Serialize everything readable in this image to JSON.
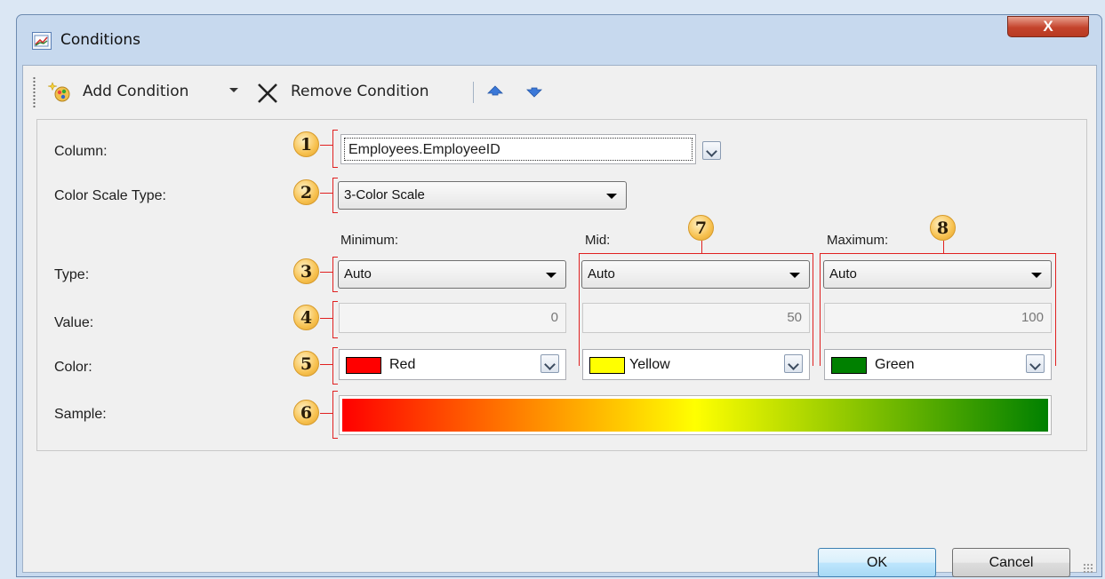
{
  "window": {
    "title": "Conditions",
    "close_glyph": "X",
    "icon": "chart-icon"
  },
  "toolbar": {
    "add_label": "Add Condition",
    "remove_label": "Remove Condition",
    "icons": [
      "add-condition-icon",
      "dropdown-arrow-icon",
      "remove-x-icon",
      "move-up-icon",
      "move-down-icon"
    ]
  },
  "form": {
    "column_label": "Column:",
    "column_value": "Employees.EmployeeID",
    "scale_type_label": "Color Scale Type:",
    "scale_type_value": "3-Color Scale",
    "type_label": "Type:",
    "value_label": "Value:",
    "color_label": "Color:",
    "sample_label": "Sample:",
    "points": [
      {
        "header": "Minimum:",
        "type": "Auto",
        "value": "0",
        "color_name": "Red",
        "color": "#ff0000"
      },
      {
        "header": "Mid:",
        "type": "Auto",
        "value": "50",
        "color_name": "Yellow",
        "color": "#ffff00"
      },
      {
        "header": "Maximum:",
        "type": "Auto",
        "value": "100",
        "color_name": "Green",
        "color": "#008000"
      }
    ],
    "sample_gradient": [
      "#ff0000",
      "#ffff00",
      "#008000"
    ]
  },
  "callouts": [
    "1",
    "2",
    "3",
    "4",
    "5",
    "6",
    "7",
    "8"
  ],
  "buttons": {
    "ok": "OK",
    "cancel": "Cancel"
  }
}
